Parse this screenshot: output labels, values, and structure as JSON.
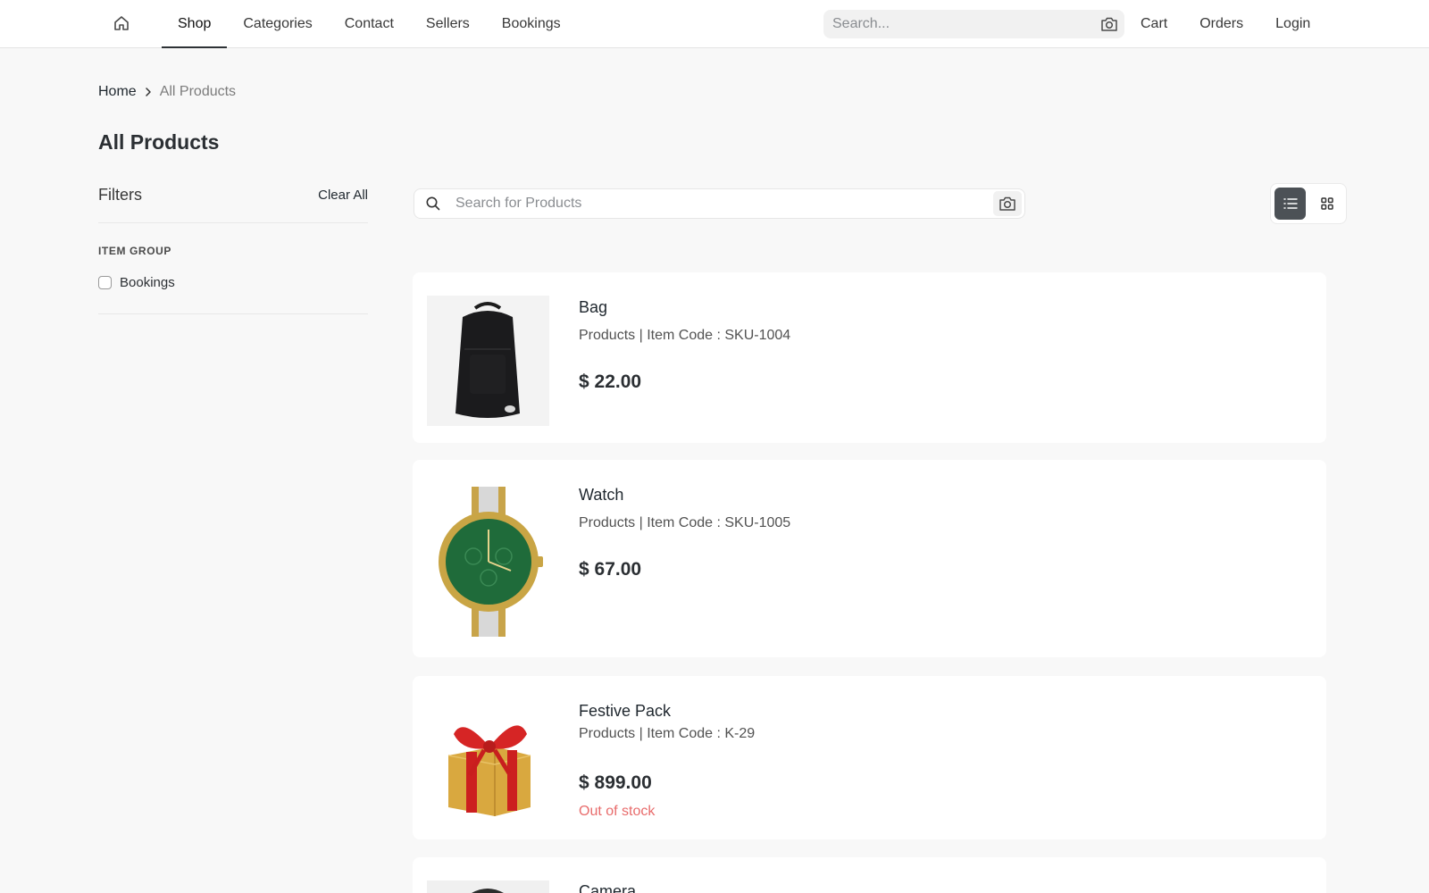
{
  "nav": {
    "home_icon": "home-icon",
    "links": [
      {
        "label": "Shop",
        "active": true
      },
      {
        "label": "Categories",
        "active": false
      },
      {
        "label": "Contact",
        "active": false
      },
      {
        "label": "Sellers",
        "active": false
      },
      {
        "label": "Bookings",
        "active": false
      }
    ],
    "search_placeholder": "Search...",
    "search_icon": "camera-icon",
    "right_links": [
      "Cart",
      "Orders",
      "Login"
    ]
  },
  "breadcrumb": {
    "home": "Home",
    "current": "All Products"
  },
  "page_title": "All Products",
  "filters": {
    "title": "Filters",
    "clear_all": "Clear All",
    "group_label": "ITEM GROUP",
    "options": [
      {
        "label": "Bookings",
        "checked": false
      }
    ]
  },
  "product_search": {
    "placeholder": "Search for Products"
  },
  "view_toggle": {
    "list_icon": "list-view-icon",
    "grid_icon": "grid-view-icon",
    "active": "list"
  },
  "products": [
    {
      "name": "Bag",
      "group": "Products",
      "separator": "|",
      "code_label": "Item Code :",
      "code": "SKU-1004",
      "price": "$ 22.00",
      "stock": "",
      "image": "backpack"
    },
    {
      "name": "Watch",
      "group": "Products",
      "separator": "|",
      "code_label": "Item Code :",
      "code": "SKU-1005",
      "price": "$ 67.00",
      "stock": "",
      "image": "watch"
    },
    {
      "name": "Festive Pack",
      "group": "Products",
      "separator": "|",
      "code_label": "Item Code :",
      "code": "K-29",
      "price": "$ 899.00",
      "stock": "Out of stock",
      "image": "gift-box"
    },
    {
      "name": "Camera",
      "group": "",
      "separator": "",
      "code_label": "",
      "code": "",
      "price": "",
      "stock": "",
      "image": "camera"
    }
  ],
  "colors": {
    "accent_dark": "#4c5156",
    "out_of_stock": "#e86c6c",
    "background": "#f8f8f8"
  }
}
